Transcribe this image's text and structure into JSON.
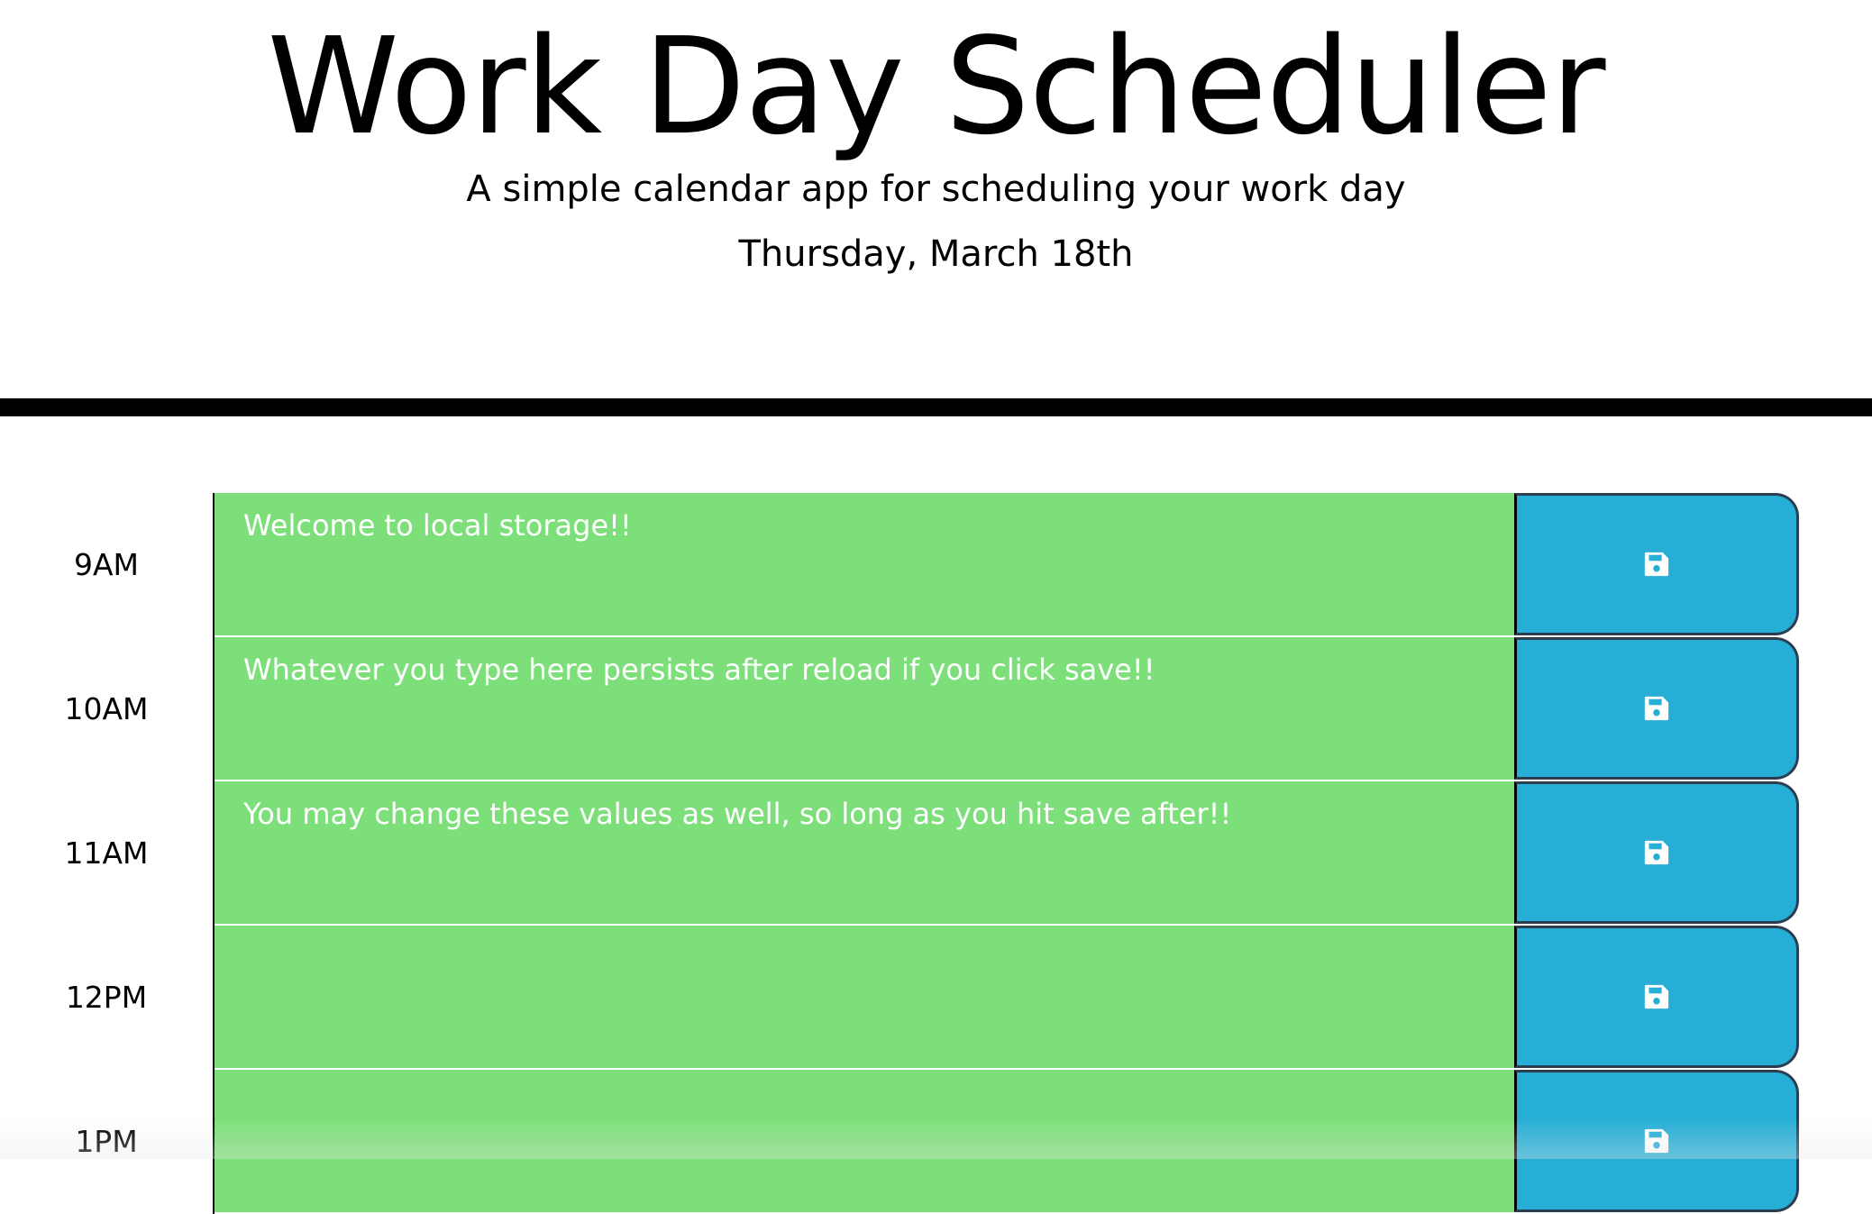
{
  "header": {
    "title": "Work Day Scheduler",
    "subtitle": "A simple calendar app for scheduling your work day",
    "current_day": "Thursday, March 18th"
  },
  "colors": {
    "present": "#7ddf7a",
    "save_button": "#27aed6",
    "divider": "#000000"
  },
  "time_blocks": [
    {
      "hour": "9AM",
      "text": "Welcome to local storage!!",
      "save_icon": "floppy-disk-icon"
    },
    {
      "hour": "10AM",
      "text": "Whatever you type here persists after reload if you click save!!",
      "save_icon": "floppy-disk-icon"
    },
    {
      "hour": "11AM",
      "text": "You may change these values as well, so long as you hit save after!!",
      "save_icon": "floppy-disk-icon"
    },
    {
      "hour": "12PM",
      "text": "",
      "save_icon": "floppy-disk-icon"
    },
    {
      "hour": "1PM",
      "text": "",
      "save_icon": "floppy-disk-icon"
    }
  ]
}
